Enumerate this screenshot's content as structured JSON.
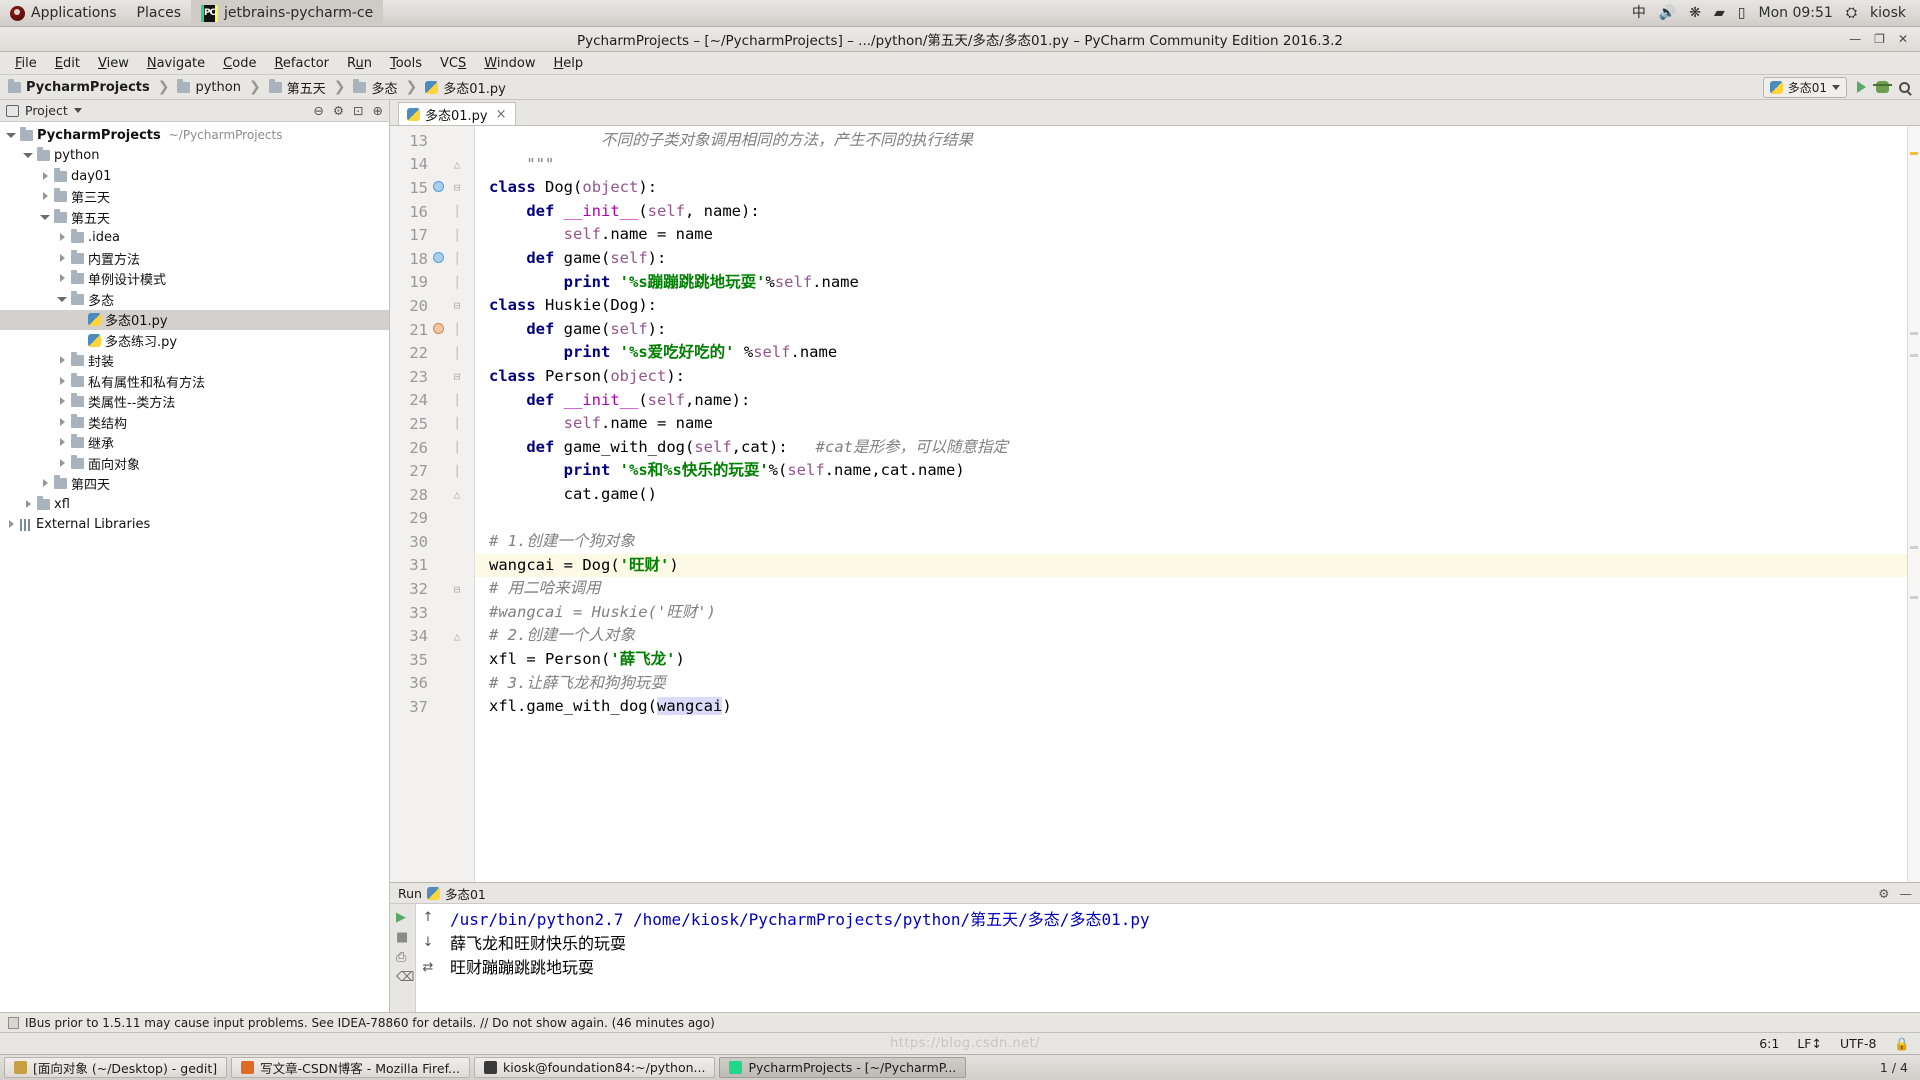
{
  "desktop": {
    "panel": {
      "applications": "Applications",
      "places": "Places",
      "window_title": "jetbrains-pycharm-ce",
      "ime": "中",
      "clock": "Mon 09:51",
      "user": "kiosk",
      "icons": [
        "volume-icon",
        "bluetooth-icon",
        "wifi-icon",
        "battery-icon"
      ]
    },
    "taskbar": {
      "items": [
        {
          "label": "[面向对象 (~/Desktop) - gedit]",
          "icon": "gedit-icon",
          "active": false
        },
        {
          "label": "写文章-CSDN博客 - Mozilla Firef...",
          "icon": "firefox-icon",
          "active": false
        },
        {
          "label": "kiosk@foundation84:~/python...",
          "icon": "terminal-icon",
          "active": false
        },
        {
          "label": "PycharmProjects - [~/PycharmP...",
          "icon": "pycharm-icon",
          "active": true
        }
      ],
      "workspace": "1 / 4"
    }
  },
  "window": {
    "title": "PycharmProjects – [~/PycharmProjects] – .../python/第五天/多态/多态01.py – PyCharm Community Edition 2016.3.2",
    "controls": {
      "minimize": "—",
      "maximize": "❐",
      "close": "✕"
    }
  },
  "menubar": {
    "items": [
      {
        "label": "File",
        "mnemonic": "F"
      },
      {
        "label": "Edit",
        "mnemonic": "E"
      },
      {
        "label": "View",
        "mnemonic": "V"
      },
      {
        "label": "Navigate",
        "mnemonic": "N"
      },
      {
        "label": "Code",
        "mnemonic": "C"
      },
      {
        "label": "Refactor",
        "mnemonic": "R"
      },
      {
        "label": "Run",
        "mnemonic": "u"
      },
      {
        "label": "Tools",
        "mnemonic": "T"
      },
      {
        "label": "VCS",
        "mnemonic": "S"
      },
      {
        "label": "Window",
        "mnemonic": "W"
      },
      {
        "label": "Help",
        "mnemonic": "H"
      }
    ]
  },
  "toolbar": {
    "breadcrumb": [
      {
        "label": "PycharmProjects",
        "icon": "folder-icon",
        "bold": true
      },
      {
        "label": "python",
        "icon": "folder-icon",
        "bold": false
      },
      {
        "label": "第五天",
        "icon": "folder-icon",
        "bold": false
      },
      {
        "label": "多态",
        "icon": "folder-icon",
        "bold": false
      },
      {
        "label": "多态01.py",
        "icon": "python-file-icon",
        "bold": false
      }
    ],
    "run_config": "多态01",
    "run_button": "run-icon",
    "debug_button": "debug-icon",
    "search_button": "search-icon"
  },
  "project_panel": {
    "header": {
      "title": "Project",
      "icons": [
        "project-view-icon",
        "chevron-down-icon",
        "collapse-icon",
        "settings-icon",
        "hide-icon",
        "target-icon"
      ]
    },
    "tree": [
      {
        "label": "PycharmProjects",
        "path": "~/PycharmProjects",
        "depth": 0,
        "state": "open",
        "kind": "root",
        "selected": false
      },
      {
        "label": "python",
        "path": "",
        "depth": 1,
        "state": "open",
        "kind": "folder",
        "selected": false
      },
      {
        "label": "day01",
        "path": "",
        "depth": 2,
        "state": "closed",
        "kind": "folder",
        "selected": false
      },
      {
        "label": "第三天",
        "path": "",
        "depth": 2,
        "state": "closed",
        "kind": "folder",
        "selected": false
      },
      {
        "label": "第五天",
        "path": "",
        "depth": 2,
        "state": "open",
        "kind": "folder",
        "selected": false
      },
      {
        "label": ".idea",
        "path": "",
        "depth": 3,
        "state": "closed",
        "kind": "folder",
        "selected": false
      },
      {
        "label": "内置方法",
        "path": "",
        "depth": 3,
        "state": "closed",
        "kind": "folder",
        "selected": false
      },
      {
        "label": "单例设计模式",
        "path": "",
        "depth": 3,
        "state": "closed",
        "kind": "folder",
        "selected": false
      },
      {
        "label": "多态",
        "path": "",
        "depth": 3,
        "state": "open",
        "kind": "folder",
        "selected": false
      },
      {
        "label": "多态01.py",
        "path": "",
        "depth": 4,
        "state": "leaf",
        "kind": "python",
        "selected": true
      },
      {
        "label": "多态练习.py",
        "path": "",
        "depth": 4,
        "state": "leaf",
        "kind": "python",
        "selected": false
      },
      {
        "label": "封装",
        "path": "",
        "depth": 3,
        "state": "closed",
        "kind": "folder",
        "selected": false
      },
      {
        "label": "私有属性和私有方法",
        "path": "",
        "depth": 3,
        "state": "closed",
        "kind": "folder",
        "selected": false
      },
      {
        "label": "类属性--类方法",
        "path": "",
        "depth": 3,
        "state": "closed",
        "kind": "folder",
        "selected": false
      },
      {
        "label": "类结构",
        "path": "",
        "depth": 3,
        "state": "closed",
        "kind": "folder",
        "selected": false
      },
      {
        "label": "继承",
        "path": "",
        "depth": 3,
        "state": "closed",
        "kind": "folder",
        "selected": false
      },
      {
        "label": "面向对象",
        "path": "",
        "depth": 3,
        "state": "closed",
        "kind": "folder",
        "selected": false
      },
      {
        "label": "第四天",
        "path": "",
        "depth": 2,
        "state": "closed",
        "kind": "folder",
        "selected": false
      },
      {
        "label": "xfl",
        "path": "",
        "depth": 1,
        "state": "closed",
        "kind": "folder",
        "selected": false
      },
      {
        "label": "External Libraries",
        "path": "",
        "depth": 0,
        "state": "closed",
        "kind": "library",
        "selected": false
      }
    ]
  },
  "editor": {
    "tabs": [
      {
        "label": "多态01.py",
        "icon": "python-file-icon",
        "close": "×",
        "active": true
      }
    ],
    "first_line": 13,
    "lines": [
      {
        "n": 13,
        "marker": "",
        "fold": "",
        "html": "<span class=\"cmt\">            不同的子类对象调用相同的方法，产生不同的执行结果</span>",
        "highlight": false
      },
      {
        "n": 14,
        "marker": "",
        "fold": "fold-end",
        "html": "<span class=\"cmt\">    \"\"\"</span>",
        "highlight": false
      },
      {
        "n": 15,
        "marker": "override-down",
        "fold": "fold-start",
        "html": "<span class=\"kw\">class</span> <span class=\"plain\">Dog</span><span class=\"plain\">(</span><span class=\"self\">object</span><span class=\"plain\">):</span>",
        "highlight": false
      },
      {
        "n": 16,
        "marker": "",
        "fold": "fold-mid",
        "html": "    <span class=\"kw\">def</span> <span class=\"magenta\">__init__</span><span class=\"plain\">(</span><span class=\"self\">self</span><span class=\"plain\">, name):</span>",
        "highlight": false
      },
      {
        "n": 17,
        "marker": "",
        "fold": "fold-mid",
        "html": "        <span class=\"self\">self</span><span class=\"plain\">.name = name</span>",
        "highlight": false
      },
      {
        "n": 18,
        "marker": "override-down",
        "fold": "fold-mid",
        "html": "    <span class=\"kw\">def</span> <span class=\"plain\">game(</span><span class=\"self\">self</span><span class=\"plain\">):</span>",
        "highlight": false
      },
      {
        "n": 19,
        "marker": "",
        "fold": "fold-mid",
        "html": "        <span class=\"kw\">print</span> <span class=\"str\">'%s蹦蹦跳跳地玩耍'</span><span class=\"plain\">%</span><span class=\"self\">self</span><span class=\"plain\">.name</span>",
        "highlight": false
      },
      {
        "n": 20,
        "marker": "",
        "fold": "fold-start",
        "html": "<span class=\"kw\">class</span> <span class=\"plain\">Huskie(Dog):</span>",
        "highlight": false
      },
      {
        "n": 21,
        "marker": "override-up",
        "fold": "fold-mid",
        "html": "    <span class=\"kw\">def</span> <span class=\"plain\">game(</span><span class=\"self\">self</span><span class=\"plain\">):</span>",
        "highlight": false
      },
      {
        "n": 22,
        "marker": "",
        "fold": "fold-mid",
        "html": "        <span class=\"kw\">print</span> <span class=\"str\">'%s爱吃好吃的'</span> <span class=\"plain\">%</span><span class=\"self\">self</span><span class=\"plain\">.name</span>",
        "highlight": false
      },
      {
        "n": 23,
        "marker": "",
        "fold": "fold-start",
        "html": "<span class=\"kw\">class</span> <span class=\"plain\">Person(</span><span class=\"self\">object</span><span class=\"plain\">):</span>",
        "highlight": false
      },
      {
        "n": 24,
        "marker": "",
        "fold": "fold-mid",
        "html": "    <span class=\"kw\">def</span> <span class=\"magenta\">__init__</span><span class=\"plain\">(</span><span class=\"self\">self</span><span class=\"plain\">,name):</span>",
        "highlight": false
      },
      {
        "n": 25,
        "marker": "",
        "fold": "fold-mid",
        "html": "        <span class=\"self\">self</span><span class=\"plain\">.name = name</span>",
        "highlight": false
      },
      {
        "n": 26,
        "marker": "",
        "fold": "fold-mid",
        "html": "    <span class=\"kw\">def</span> <span class=\"plain\">game_with_dog(</span><span class=\"self\">self</span><span class=\"plain\">,cat):</span>   <span class=\"cmt\">#cat是形参，可以随意指定</span>",
        "highlight": false
      },
      {
        "n": 27,
        "marker": "",
        "fold": "fold-mid",
        "html": "        <span class=\"kw\">print</span> <span class=\"str\">'%s和%s快乐的玩耍'</span><span class=\"plain\">%(</span><span class=\"self\">self</span><span class=\"plain\">.name,cat.name)</span>",
        "highlight": false
      },
      {
        "n": 28,
        "marker": "",
        "fold": "fold-end",
        "html": "        <span class=\"plain\">cat.game()</span>",
        "highlight": false
      },
      {
        "n": 29,
        "marker": "",
        "fold": "",
        "html": "",
        "highlight": false
      },
      {
        "n": 30,
        "marker": "",
        "fold": "",
        "html": "<span class=\"cmt\"># 1.创建一个狗对象</span>",
        "highlight": false
      },
      {
        "n": 31,
        "marker": "",
        "fold": "",
        "html": "<span class=\"plain\">wangcai = Dog(</span><span class=\"str\">'旺财'</span><span class=\"plain\">)</span>",
        "highlight": true
      },
      {
        "n": 32,
        "marker": "",
        "fold": "fold-start",
        "html": "<span class=\"cmt\"># 用二哈来调用</span>",
        "highlight": false
      },
      {
        "n": 33,
        "marker": "",
        "fold": "",
        "html": "<span class=\"cmt\">#wangcai = Huskie('旺财')</span>",
        "highlight": false
      },
      {
        "n": 34,
        "marker": "",
        "fold": "fold-end",
        "html": "<span class=\"cmt\"># 2.创建一个人对象</span>",
        "highlight": false
      },
      {
        "n": 35,
        "marker": "",
        "fold": "",
        "html": "<span class=\"plain\">xfl = Person(</span><span class=\"str\">'薛飞龙'</span><span class=\"plain\">)</span>",
        "highlight": false
      },
      {
        "n": 36,
        "marker": "",
        "fold": "",
        "html": "<span class=\"cmt\"># 3.让薛飞龙和狗狗玩耍</span>",
        "highlight": false
      },
      {
        "n": 37,
        "marker": "",
        "fold": "",
        "html": "<span class=\"plain\">xfl.game_with_dog(</span><span class=\"sel-ident\">wangcai</span><span class=\"plain\">)</span>",
        "highlight": false
      }
    ]
  },
  "run_panel": {
    "title": "Run",
    "config_name": "多态01",
    "header_icons": [
      "settings-icon",
      "minimize-icon"
    ],
    "console_lines": [
      {
        "text": "/usr/bin/python2.7 /home/kiosk/PycharmProjects/python/第五天/多态/多态01.py",
        "style": "blue"
      },
      {
        "text": "薛飞龙和旺财快乐的玩耍",
        "style": "black"
      },
      {
        "text": "旺财蹦蹦跳跳地玩耍",
        "style": "black"
      }
    ],
    "side_icons": [
      "rerun-icon",
      "stop-icon",
      "print-icon",
      "scroll-up-icon",
      "scroll-down-icon",
      "soft-wrap-icon",
      "clear-icon"
    ]
  },
  "notification": {
    "text": "IBus prior to 1.5.11 may cause input problems. See IDEA-78860 for details. // Do not show again. (46 minutes ago)",
    "icon": "info-icon"
  },
  "status_bar": {
    "caret": "6:1",
    "line_sep": "LF↕",
    "encoding": "UTF-8",
    "lock": "lock-icon",
    "watermark": "https://blog.csdn.net/"
  },
  "colors": {
    "keyword": "#000080",
    "string": "#008000",
    "comment": "#808080",
    "self": "#94558d",
    "magenta": "#b200b2",
    "selection": "#dcdcfa",
    "caret_row": "#fcf9e4",
    "chrome": "#e8e6e3"
  }
}
